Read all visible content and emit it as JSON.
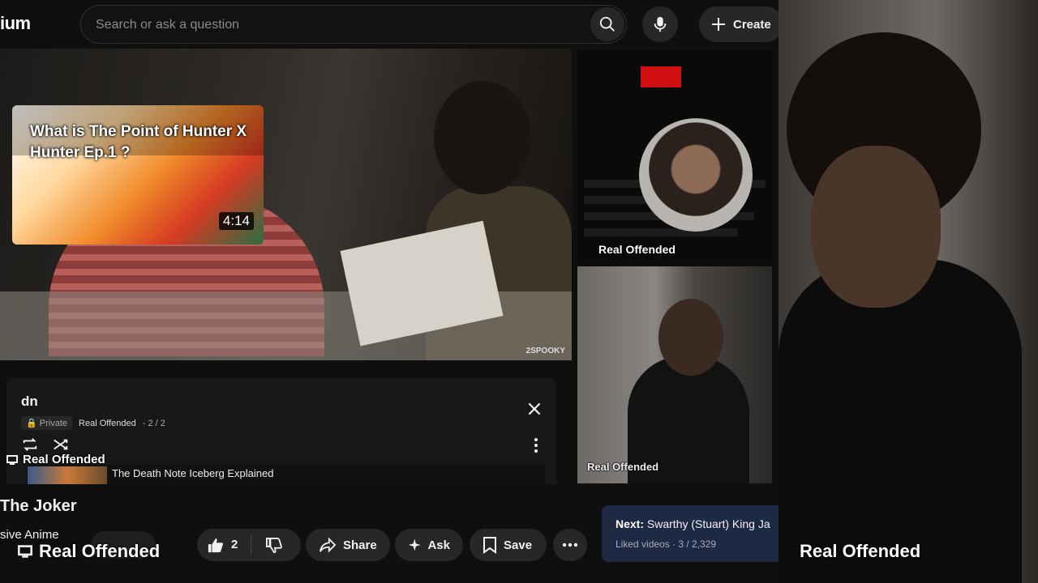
{
  "header": {
    "logo_partial": "ium",
    "search_placeholder": "Search or ask a question",
    "create_label": "Create"
  },
  "thumbnail_card": {
    "title": "What is The Point of Hunter X Hunter Ep.1 ?",
    "duration": "4:14"
  },
  "main_video": {
    "watermark": "2SPOOKY"
  },
  "playlist": {
    "title": "dn",
    "privacy": "Private",
    "channel": "Real Offended",
    "position": "- 2 / 2",
    "current_item_title": "The Death Note Iceberg Explained",
    "overlay_label": "Real Offended"
  },
  "video": {
    "title": "The Joker",
    "channel_partial": "sive Anime",
    "like_count": "2",
    "share_label": "Share",
    "ask_label": "Ask",
    "save_label": "Save"
  },
  "up_next": {
    "prefix": "Next:",
    "title": "Swarthy (Stuart) King Ja",
    "subtitle": "Liked videos · 3 / 2,329"
  },
  "overlays": {
    "embed_label": "Real Offended",
    "cam2_label": "Real Offended",
    "bottom_label": "Real Offended",
    "cam3_label": "Real Offended"
  },
  "colors": {
    "background": "#0f0f0f",
    "pill": "#272727",
    "upnext_bg": "#1e2a44",
    "embed_red": "#d01010"
  }
}
